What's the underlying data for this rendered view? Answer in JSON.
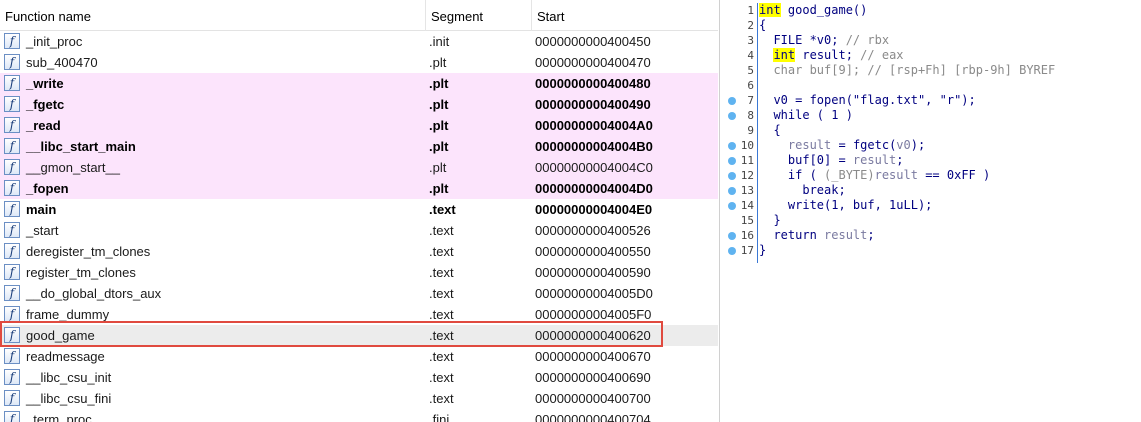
{
  "functions": {
    "headers": {
      "name": "Function name",
      "segment": "Segment",
      "start": "Start"
    },
    "icon": "function-icon",
    "rows": [
      {
        "name": "_init_proc",
        "segment": ".init",
        "start": "0000000000400450",
        "style": "normal"
      },
      {
        "name": "sub_400470",
        "segment": ".plt",
        "start": "0000000000400470",
        "style": "normal"
      },
      {
        "name": "_write",
        "segment": ".plt",
        "start": "0000000000400480",
        "style": "pink-bold"
      },
      {
        "name": "_fgetc",
        "segment": ".plt",
        "start": "0000000000400490",
        "style": "pink-bold"
      },
      {
        "name": "_read",
        "segment": ".plt",
        "start": "00000000004004A0",
        "style": "pink-bold"
      },
      {
        "name": "__libc_start_main",
        "segment": ".plt",
        "start": "00000000004004B0",
        "style": "pink-bold"
      },
      {
        "name": "__gmon_start__",
        "segment": ".plt",
        "start": "00000000004004C0",
        "style": "pink"
      },
      {
        "name": "_fopen",
        "segment": ".plt",
        "start": "00000000004004D0",
        "style": "pink-bold"
      },
      {
        "name": "main",
        "segment": ".text",
        "start": "00000000004004E0",
        "style": "bold"
      },
      {
        "name": "_start",
        "segment": ".text",
        "start": "0000000000400526",
        "style": "normal"
      },
      {
        "name": "deregister_tm_clones",
        "segment": ".text",
        "start": "0000000000400550",
        "style": "normal"
      },
      {
        "name": "register_tm_clones",
        "segment": ".text",
        "start": "0000000000400590",
        "style": "normal"
      },
      {
        "name": "__do_global_dtors_aux",
        "segment": ".text",
        "start": "00000000004005D0",
        "style": "normal"
      },
      {
        "name": "frame_dummy",
        "segment": ".text",
        "start": "00000000004005F0",
        "style": "normal"
      },
      {
        "name": "good_game",
        "segment": ".text",
        "start": "0000000000400620",
        "style": "selected"
      },
      {
        "name": "readmessage",
        "segment": ".text",
        "start": "0000000000400670",
        "style": "normal"
      },
      {
        "name": "__libc_csu_init",
        "segment": ".text",
        "start": "0000000000400690",
        "style": "normal"
      },
      {
        "name": "__libc_csu_fini",
        "segment": ".text",
        "start": "0000000000400700",
        "style": "normal"
      },
      {
        "name": "_term_proc",
        "segment": ".fini",
        "start": "0000000000400704",
        "style": "normal"
      }
    ],
    "highlight_color": "#e04a3f",
    "pink_color": "#fce4fc"
  },
  "pseudocode": {
    "lines": [
      {
        "num": "1",
        "dot": false,
        "segs": [
          [
            "int",
            "kw"
          ],
          [
            " good_game()",
            ""
          ]
        ]
      },
      {
        "num": "2",
        "dot": false,
        "segs": [
          [
            "{",
            ""
          ]
        ]
      },
      {
        "num": "3",
        "dot": false,
        "segs": [
          [
            "  FILE *v0; ",
            ""
          ],
          [
            "// rbx",
            "cm"
          ]
        ]
      },
      {
        "num": "4",
        "dot": false,
        "segs": [
          [
            "  ",
            ""
          ],
          [
            "int",
            "kw"
          ],
          [
            " result; ",
            ""
          ],
          [
            "// eax",
            "cm"
          ]
        ]
      },
      {
        "num": "5",
        "dot": false,
        "segs": [
          [
            "  char buf[9]; ",
            "ty"
          ],
          [
            "// [rsp+Fh] [rbp-9h] BYREF",
            "cm"
          ]
        ]
      },
      {
        "num": "6",
        "dot": false,
        "segs": [
          [
            "",
            ""
          ]
        ]
      },
      {
        "num": "7",
        "dot": true,
        "segs": [
          [
            "  v0 = fopen(\"flag.txt\", \"r\");",
            ""
          ]
        ]
      },
      {
        "num": "8",
        "dot": true,
        "segs": [
          [
            "  while ( 1 )",
            ""
          ]
        ]
      },
      {
        "num": "9",
        "dot": false,
        "segs": [
          [
            "  {",
            ""
          ]
        ]
      },
      {
        "num": "10",
        "dot": true,
        "segs": [
          [
            "    ",
            ""
          ],
          [
            "result",
            "var"
          ],
          [
            " = fgetc(",
            ""
          ],
          [
            "v0",
            "var"
          ],
          [
            ");",
            ""
          ]
        ]
      },
      {
        "num": "11",
        "dot": true,
        "segs": [
          [
            "    buf[0] = ",
            ""
          ],
          [
            "result",
            "var"
          ],
          [
            ";",
            ""
          ]
        ]
      },
      {
        "num": "12",
        "dot": true,
        "segs": [
          [
            "    if ( ",
            ""
          ],
          [
            "(_BYTE)",
            "ty"
          ],
          [
            "result",
            "var"
          ],
          [
            " == 0xFF )",
            ""
          ]
        ]
      },
      {
        "num": "13",
        "dot": true,
        "segs": [
          [
            "      break;",
            ""
          ]
        ]
      },
      {
        "num": "14",
        "dot": true,
        "segs": [
          [
            "    write(1, buf, 1uLL);",
            ""
          ]
        ]
      },
      {
        "num": "15",
        "dot": false,
        "segs": [
          [
            "  }",
            ""
          ]
        ]
      },
      {
        "num": "16",
        "dot": true,
        "segs": [
          [
            "  return ",
            ""
          ],
          [
            "result",
            "var"
          ],
          [
            ";",
            ""
          ]
        ]
      },
      {
        "num": "17",
        "dot": true,
        "segs": [
          [
            "}",
            ""
          ]
        ]
      }
    ],
    "dot_color": "#5fb3f0",
    "gutter_line_color": "#3a78d4"
  }
}
